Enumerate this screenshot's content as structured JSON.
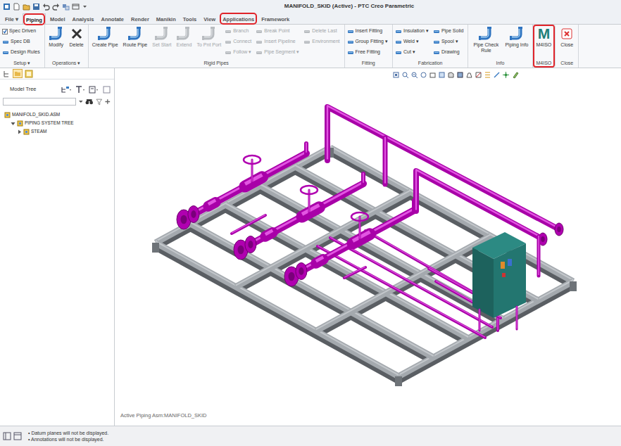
{
  "window": {
    "title": "MANIFOLD_SKID (Active) - PTC Creo Parametric"
  },
  "tabs": [
    {
      "label": "File ▾",
      "selected": false,
      "annotated": false
    },
    {
      "label": "Piping",
      "selected": true,
      "annotated": true
    },
    {
      "label": "Model",
      "selected": false,
      "annotated": false
    },
    {
      "label": "Analysis",
      "selected": false,
      "annotated": false
    },
    {
      "label": "Annotate",
      "selected": false,
      "annotated": false
    },
    {
      "label": "Render",
      "selected": false,
      "annotated": false
    },
    {
      "label": "Manikin",
      "selected": false,
      "annotated": false
    },
    {
      "label": "Tools",
      "selected": false,
      "annotated": false
    },
    {
      "label": "View",
      "selected": false,
      "annotated": false
    },
    {
      "label": "Applications",
      "selected": false,
      "annotated": true
    },
    {
      "label": "Framework",
      "selected": false,
      "annotated": false
    }
  ],
  "ribbon": {
    "groups": [
      {
        "label": "Setup ▾",
        "annotated": false,
        "items": [
          {
            "label": "Spec Driven",
            "kind": "check",
            "checked": true,
            "disabled": false
          },
          {
            "label": "Spec DB",
            "kind": "small",
            "disabled": false
          },
          {
            "label": "Design Rules",
            "kind": "small",
            "disabled": false
          }
        ]
      },
      {
        "label": "Operations ▾",
        "annotated": false,
        "items": [
          {
            "label": "Modify",
            "kind": "large",
            "disabled": false
          },
          {
            "label": "Delete",
            "kind": "delete",
            "disabled": false
          }
        ]
      },
      {
        "label": "Rigid Pipes",
        "annotated": false,
        "items": [
          {
            "label": "Create Pipe",
            "kind": "large",
            "disabled": false
          },
          {
            "label": "Route Pipe",
            "kind": "large",
            "disabled": false
          },
          {
            "label": "Set Start",
            "kind": "large",
            "disabled": true
          },
          {
            "label": "Extend",
            "kind": "large",
            "disabled": true
          },
          {
            "label": "To Pnt Port",
            "kind": "large",
            "disabled": true
          },
          {
            "label": "Branch",
            "kind": "small",
            "disabled": true
          },
          {
            "label": "Connect",
            "kind": "small",
            "disabled": true
          },
          {
            "label": "Follow ▾",
            "kind": "small",
            "disabled": true
          },
          {
            "label": "Break Point",
            "kind": "small",
            "disabled": true
          },
          {
            "label": "Insert Pipeline",
            "kind": "small",
            "disabled": true
          },
          {
            "label": "Pipe Segment ▾",
            "kind": "small",
            "disabled": true
          },
          {
            "label": "Delete Last",
            "kind": "small",
            "disabled": true
          },
          {
            "label": "Environment",
            "kind": "small",
            "disabled": true
          }
        ]
      },
      {
        "label": "Fitting",
        "annotated": false,
        "items": [
          {
            "label": "Insert Fitting",
            "kind": "small",
            "disabled": false
          },
          {
            "label": "Group Fitting ▾",
            "kind": "small",
            "disabled": false
          },
          {
            "label": "Free Fitting",
            "kind": "small",
            "disabled": false
          }
        ]
      },
      {
        "label": "Fabrication",
        "annotated": false,
        "items": [
          {
            "label": "Insulation ▾",
            "kind": "small",
            "disabled": false
          },
          {
            "label": "Weld ▾",
            "kind": "small",
            "disabled": false
          },
          {
            "label": "Cut ▾",
            "kind": "small",
            "disabled": false
          },
          {
            "label": "Pipe Solid",
            "kind": "small",
            "disabled": false
          },
          {
            "label": "Spool ▾",
            "kind": "small",
            "disabled": false
          },
          {
            "label": "Drawing",
            "kind": "small",
            "disabled": false
          }
        ]
      },
      {
        "label": "Info",
        "annotated": false,
        "items": [
          {
            "label": "Pipe Check Rule",
            "kind": "large",
            "disabled": false
          },
          {
            "label": "Piping Info",
            "kind": "large",
            "disabled": false
          }
        ]
      },
      {
        "label": "M4ISO",
        "annotated": true,
        "items": [
          {
            "label": "M4ISO",
            "kind": "logo",
            "logo": "M",
            "disabled": false
          }
        ]
      },
      {
        "label": "Close",
        "annotated": false,
        "items": [
          {
            "label": "Close",
            "kind": "close",
            "disabled": false
          }
        ]
      }
    ]
  },
  "model_tree": {
    "title": "Model Tree",
    "items": [
      {
        "label": "MANIFOLD_SKID.ASM",
        "depth": 0
      },
      {
        "label": "PIPING SYSTEM TREE",
        "depth": 1,
        "expanded": true
      },
      {
        "label": "STEAM",
        "depth": 2,
        "expanded": false
      }
    ]
  },
  "viewport": {
    "active_model": "Active Piping Asm:MANIFOLD_SKID"
  },
  "status_bar": {
    "messages": [
      "• Datum planes will not be displayed.",
      "• Annotations will not be displayed."
    ]
  }
}
